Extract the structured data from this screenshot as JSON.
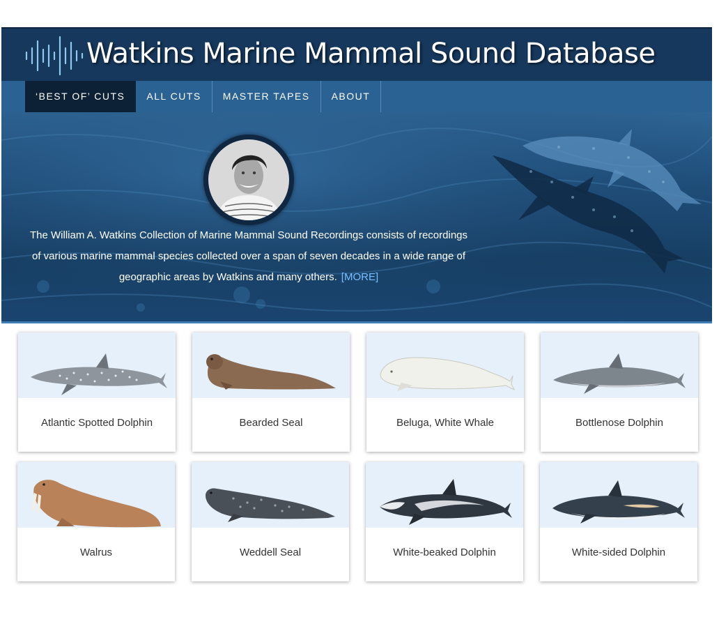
{
  "site": {
    "title": "Watkins Marine Mammal Sound Database",
    "colors": {
      "header": "#16385c",
      "nav": "#2a6293",
      "nav_active": "#0d2136",
      "link": "#79bfff",
      "card_image_bg": "#e5f0fb"
    }
  },
  "nav": {
    "items": [
      {
        "label": "‘BEST OF’ CUTS",
        "active": true
      },
      {
        "label": "ALL CUTS",
        "active": false
      },
      {
        "label": "MASTER TAPES",
        "active": false
      },
      {
        "label": "ABOUT",
        "active": false
      }
    ]
  },
  "hero": {
    "portrait_icon": "watkins-portrait",
    "description": "The William A. Watkins Collection of Marine Mammal Sound Recordings consists of recordings of various marine mammal species collected over a span of seven decades in a wide range of geographic areas by Watkins and many others.",
    "more_open": "[",
    "more_label": "MORE",
    "more_close": "]"
  },
  "species": [
    {
      "name": "Atlantic Spotted Dolphin",
      "icon": "atlantic-spotted-dolphin-icon"
    },
    {
      "name": "Bearded Seal",
      "icon": "bearded-seal-icon"
    },
    {
      "name": "Beluga, White Whale",
      "icon": "beluga-icon"
    },
    {
      "name": "Bottlenose Dolphin",
      "icon": "bottlenose-dolphin-icon"
    },
    {
      "name": "Walrus",
      "icon": "walrus-icon"
    },
    {
      "name": "Weddell Seal",
      "icon": "weddell-seal-icon"
    },
    {
      "name": "White-beaked Dolphin",
      "icon": "white-beaked-dolphin-icon"
    },
    {
      "name": "White-sided Dolphin",
      "icon": "white-sided-dolphin-icon"
    }
  ]
}
